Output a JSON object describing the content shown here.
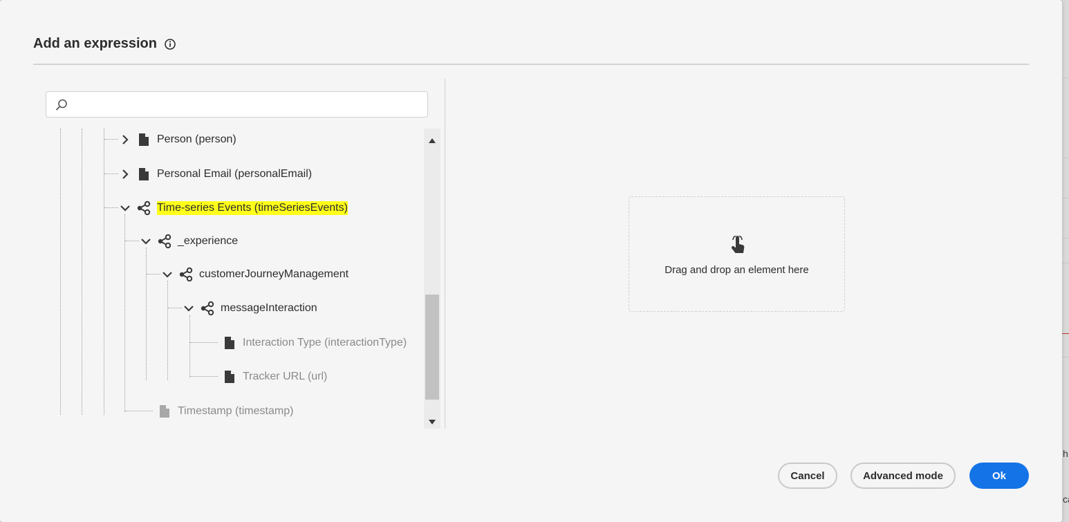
{
  "dialog": {
    "title": "Add an expression",
    "info_icon": "info-icon"
  },
  "search": {
    "value": "",
    "placeholder": "",
    "icon": "search-icon"
  },
  "tree": {
    "items": [
      {
        "label": "Person (person)",
        "expander": "chevron-right",
        "icon": "file-icon",
        "muted": false,
        "highlighted": false
      },
      {
        "label": "Personal Email (personalEmail)",
        "expander": "chevron-right",
        "icon": "file-icon",
        "muted": false,
        "highlighted": false
      },
      {
        "label": "Time-series Events (timeSeriesEvents)",
        "expander": "chevron-down",
        "icon": "share-node-icon",
        "muted": false,
        "highlighted": true
      },
      {
        "label": "_experience",
        "expander": "chevron-down",
        "icon": "share-node-icon",
        "muted": false,
        "highlighted": false
      },
      {
        "label": "customerJourneyManagement",
        "expander": "chevron-down",
        "icon": "share-node-icon",
        "muted": false,
        "highlighted": false
      },
      {
        "label": "messageInteraction",
        "expander": "chevron-down",
        "icon": "share-node-icon",
        "muted": false,
        "highlighted": false
      },
      {
        "label": "Interaction Type (interactionType)",
        "expander": "none",
        "icon": "file-icon",
        "muted": true,
        "highlighted": false
      },
      {
        "label": "Tracker URL (url)",
        "expander": "none",
        "icon": "file-icon",
        "muted": true,
        "highlighted": false
      },
      {
        "label": "Timestamp (timestamp)",
        "expander": "none",
        "icon": "file-icon",
        "muted": true,
        "highlighted": false
      }
    ],
    "highlight_color": "#ffff1a"
  },
  "dropzone": {
    "text": "Drag and drop an element here",
    "icon": "touch-hand-icon"
  },
  "footer": {
    "cancel_label": "Cancel",
    "advanced_label": "Advanced mode",
    "ok_label": "Ok"
  },
  "colors": {
    "accent": "#1473e6",
    "muted_text": "#8a8a8a"
  },
  "backdrop": {
    "edge_text_1": "h",
    "edge_text_2": "ca"
  }
}
